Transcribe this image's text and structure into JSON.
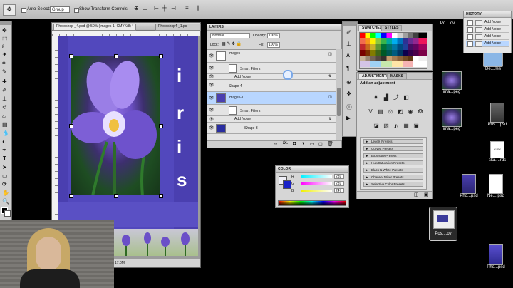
{
  "options_bar": {
    "auto_select_label": "Auto-Select:",
    "auto_select_value": "Group",
    "transform_label": "Show Transform Controls"
  },
  "document": {
    "tabs": [
      {
        "label": "Photoshop _4.psd @ 50% (images-1, CMYK/8) *"
      },
      {
        "label": "Photoshop4 _1.ps"
      }
    ],
    "status_text": "17.0M",
    "artwork_text": [
      "i",
      "r",
      "i",
      "s"
    ]
  },
  "layers": {
    "title": "LAYERS",
    "blend_mode": "Normal",
    "opacity_label": "Opacity:",
    "opacity_value": "100%",
    "lock_label": "Lock:",
    "fill_label": "Fill:",
    "fill_value": "100%",
    "items": [
      {
        "name": "images"
      },
      {
        "name": "Smart Filters"
      },
      {
        "name": "Add Noise"
      },
      {
        "name": "Shape 4"
      },
      {
        "name": "images-1"
      },
      {
        "name": "Smart Filters"
      },
      {
        "name": "Add Noise"
      },
      {
        "name": "Shape 3"
      }
    ],
    "footer_icons": [
      "link-icon",
      "fx-icon",
      "mask-icon",
      "adjustment-icon",
      "folder-icon",
      "new-layer-icon",
      "trash-icon"
    ]
  },
  "swatches": {
    "tabs": [
      "SWATCHES",
      "STYLES"
    ]
  },
  "adjustments": {
    "tabs": [
      "ADJUSTMENTS",
      "MASKS"
    ],
    "heading": "Add an adjustment",
    "presets": [
      "Levels Presets",
      "Curves Presets",
      "Exposure Presets",
      "Hue/Saturation Presets",
      "Black & White Presets",
      "Channel Mixer Presets",
      "Selective Color Presets"
    ]
  },
  "history": {
    "title": "HISTORY",
    "items": [
      "Add Noise",
      "Add Noise",
      "Add Noise",
      "Add Noise"
    ]
  },
  "color": {
    "title": "COLOR",
    "channels": [
      {
        "letter": "R",
        "value": "239"
      },
      {
        "letter": "G",
        "value": "239"
      },
      {
        "letter": "B",
        "value": "247"
      }
    ]
  },
  "desktop_files": [
    {
      "label": "Po....ov"
    },
    {
      "label": "De....les"
    },
    {
      "label": "ima...peg"
    },
    {
      "label": "ima...peg"
    },
    {
      "label": "Pos....psd"
    },
    {
      "label": "ska....rds"
    },
    {
      "label": "Pho...psd"
    },
    {
      "label": "Ne....psd"
    },
    {
      "label": "Pos....ov"
    },
    {
      "label": "Pho...psd"
    }
  ],
  "colors": {
    "doc_blue": "#4a3fb0",
    "highlight": "#b8d6ff"
  }
}
